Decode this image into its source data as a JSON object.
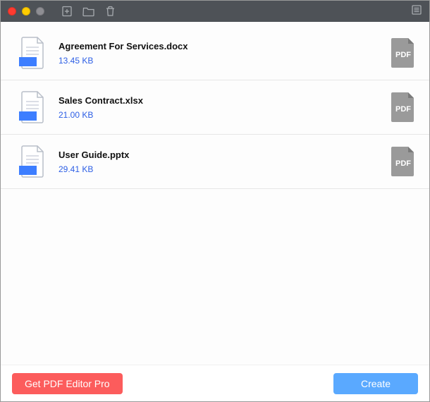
{
  "titlebar": {
    "icons": [
      "add-file",
      "folder",
      "trash",
      "list"
    ]
  },
  "files": [
    {
      "name": "Agreement For Services.docx",
      "size": "13.45 KB"
    },
    {
      "name": "Sales Contract.xlsx",
      "size": "21.00 KB"
    },
    {
      "name": "User Guide.pptx",
      "size": "29.41 KB"
    }
  ],
  "pdf_badge_label": "PDF",
  "footer": {
    "pro_label": "Get PDF Editor Pro",
    "create_label": "Create"
  },
  "colors": {
    "accent_red": "#fc5c5c",
    "accent_blue": "#5aa9ff",
    "link_blue": "#2d5fe5",
    "titlebar": "#4e5257"
  }
}
